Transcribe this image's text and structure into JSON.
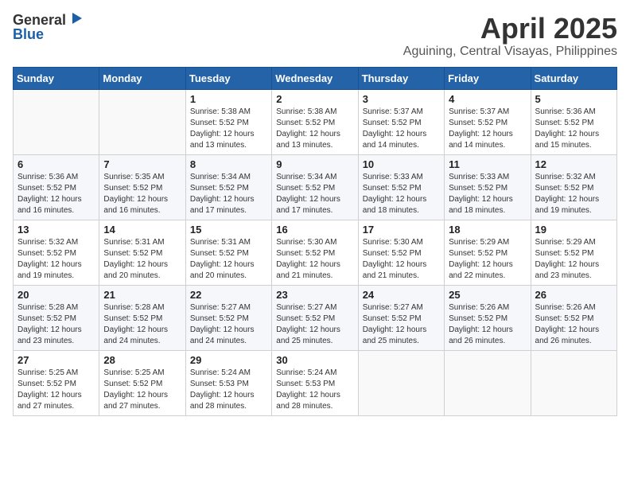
{
  "header": {
    "logo_general": "General",
    "logo_blue": "Blue",
    "month_year": "April 2025",
    "location": "Aguining, Central Visayas, Philippines"
  },
  "weekdays": [
    "Sunday",
    "Monday",
    "Tuesday",
    "Wednesday",
    "Thursday",
    "Friday",
    "Saturday"
  ],
  "weeks": [
    [
      {
        "day": "",
        "sunrise": "",
        "sunset": "",
        "daylight": ""
      },
      {
        "day": "",
        "sunrise": "",
        "sunset": "",
        "daylight": ""
      },
      {
        "day": "1",
        "sunrise": "Sunrise: 5:38 AM",
        "sunset": "Sunset: 5:52 PM",
        "daylight": "Daylight: 12 hours and 13 minutes."
      },
      {
        "day": "2",
        "sunrise": "Sunrise: 5:38 AM",
        "sunset": "Sunset: 5:52 PM",
        "daylight": "Daylight: 12 hours and 13 minutes."
      },
      {
        "day": "3",
        "sunrise": "Sunrise: 5:37 AM",
        "sunset": "Sunset: 5:52 PM",
        "daylight": "Daylight: 12 hours and 14 minutes."
      },
      {
        "day": "4",
        "sunrise": "Sunrise: 5:37 AM",
        "sunset": "Sunset: 5:52 PM",
        "daylight": "Daylight: 12 hours and 14 minutes."
      },
      {
        "day": "5",
        "sunrise": "Sunrise: 5:36 AM",
        "sunset": "Sunset: 5:52 PM",
        "daylight": "Daylight: 12 hours and 15 minutes."
      }
    ],
    [
      {
        "day": "6",
        "sunrise": "Sunrise: 5:36 AM",
        "sunset": "Sunset: 5:52 PM",
        "daylight": "Daylight: 12 hours and 16 minutes."
      },
      {
        "day": "7",
        "sunrise": "Sunrise: 5:35 AM",
        "sunset": "Sunset: 5:52 PM",
        "daylight": "Daylight: 12 hours and 16 minutes."
      },
      {
        "day": "8",
        "sunrise": "Sunrise: 5:34 AM",
        "sunset": "Sunset: 5:52 PM",
        "daylight": "Daylight: 12 hours and 17 minutes."
      },
      {
        "day": "9",
        "sunrise": "Sunrise: 5:34 AM",
        "sunset": "Sunset: 5:52 PM",
        "daylight": "Daylight: 12 hours and 17 minutes."
      },
      {
        "day": "10",
        "sunrise": "Sunrise: 5:33 AM",
        "sunset": "Sunset: 5:52 PM",
        "daylight": "Daylight: 12 hours and 18 minutes."
      },
      {
        "day": "11",
        "sunrise": "Sunrise: 5:33 AM",
        "sunset": "Sunset: 5:52 PM",
        "daylight": "Daylight: 12 hours and 18 minutes."
      },
      {
        "day": "12",
        "sunrise": "Sunrise: 5:32 AM",
        "sunset": "Sunset: 5:52 PM",
        "daylight": "Daylight: 12 hours and 19 minutes."
      }
    ],
    [
      {
        "day": "13",
        "sunrise": "Sunrise: 5:32 AM",
        "sunset": "Sunset: 5:52 PM",
        "daylight": "Daylight: 12 hours and 19 minutes."
      },
      {
        "day": "14",
        "sunrise": "Sunrise: 5:31 AM",
        "sunset": "Sunset: 5:52 PM",
        "daylight": "Daylight: 12 hours and 20 minutes."
      },
      {
        "day": "15",
        "sunrise": "Sunrise: 5:31 AM",
        "sunset": "Sunset: 5:52 PM",
        "daylight": "Daylight: 12 hours and 20 minutes."
      },
      {
        "day": "16",
        "sunrise": "Sunrise: 5:30 AM",
        "sunset": "Sunset: 5:52 PM",
        "daylight": "Daylight: 12 hours and 21 minutes."
      },
      {
        "day": "17",
        "sunrise": "Sunrise: 5:30 AM",
        "sunset": "Sunset: 5:52 PM",
        "daylight": "Daylight: 12 hours and 21 minutes."
      },
      {
        "day": "18",
        "sunrise": "Sunrise: 5:29 AM",
        "sunset": "Sunset: 5:52 PM",
        "daylight": "Daylight: 12 hours and 22 minutes."
      },
      {
        "day": "19",
        "sunrise": "Sunrise: 5:29 AM",
        "sunset": "Sunset: 5:52 PM",
        "daylight": "Daylight: 12 hours and 23 minutes."
      }
    ],
    [
      {
        "day": "20",
        "sunrise": "Sunrise: 5:28 AM",
        "sunset": "Sunset: 5:52 PM",
        "daylight": "Daylight: 12 hours and 23 minutes."
      },
      {
        "day": "21",
        "sunrise": "Sunrise: 5:28 AM",
        "sunset": "Sunset: 5:52 PM",
        "daylight": "Daylight: 12 hours and 24 minutes."
      },
      {
        "day": "22",
        "sunrise": "Sunrise: 5:27 AM",
        "sunset": "Sunset: 5:52 PM",
        "daylight": "Daylight: 12 hours and 24 minutes."
      },
      {
        "day": "23",
        "sunrise": "Sunrise: 5:27 AM",
        "sunset": "Sunset: 5:52 PM",
        "daylight": "Daylight: 12 hours and 25 minutes."
      },
      {
        "day": "24",
        "sunrise": "Sunrise: 5:27 AM",
        "sunset": "Sunset: 5:52 PM",
        "daylight": "Daylight: 12 hours and 25 minutes."
      },
      {
        "day": "25",
        "sunrise": "Sunrise: 5:26 AM",
        "sunset": "Sunset: 5:52 PM",
        "daylight": "Daylight: 12 hours and 26 minutes."
      },
      {
        "day": "26",
        "sunrise": "Sunrise: 5:26 AM",
        "sunset": "Sunset: 5:52 PM",
        "daylight": "Daylight: 12 hours and 26 minutes."
      }
    ],
    [
      {
        "day": "27",
        "sunrise": "Sunrise: 5:25 AM",
        "sunset": "Sunset: 5:52 PM",
        "daylight": "Daylight: 12 hours and 27 minutes."
      },
      {
        "day": "28",
        "sunrise": "Sunrise: 5:25 AM",
        "sunset": "Sunset: 5:52 PM",
        "daylight": "Daylight: 12 hours and 27 minutes."
      },
      {
        "day": "29",
        "sunrise": "Sunrise: 5:24 AM",
        "sunset": "Sunset: 5:53 PM",
        "daylight": "Daylight: 12 hours and 28 minutes."
      },
      {
        "day": "30",
        "sunrise": "Sunrise: 5:24 AM",
        "sunset": "Sunset: 5:53 PM",
        "daylight": "Daylight: 12 hours and 28 minutes."
      },
      {
        "day": "",
        "sunrise": "",
        "sunset": "",
        "daylight": ""
      },
      {
        "day": "",
        "sunrise": "",
        "sunset": "",
        "daylight": ""
      },
      {
        "day": "",
        "sunrise": "",
        "sunset": "",
        "daylight": ""
      }
    ]
  ]
}
